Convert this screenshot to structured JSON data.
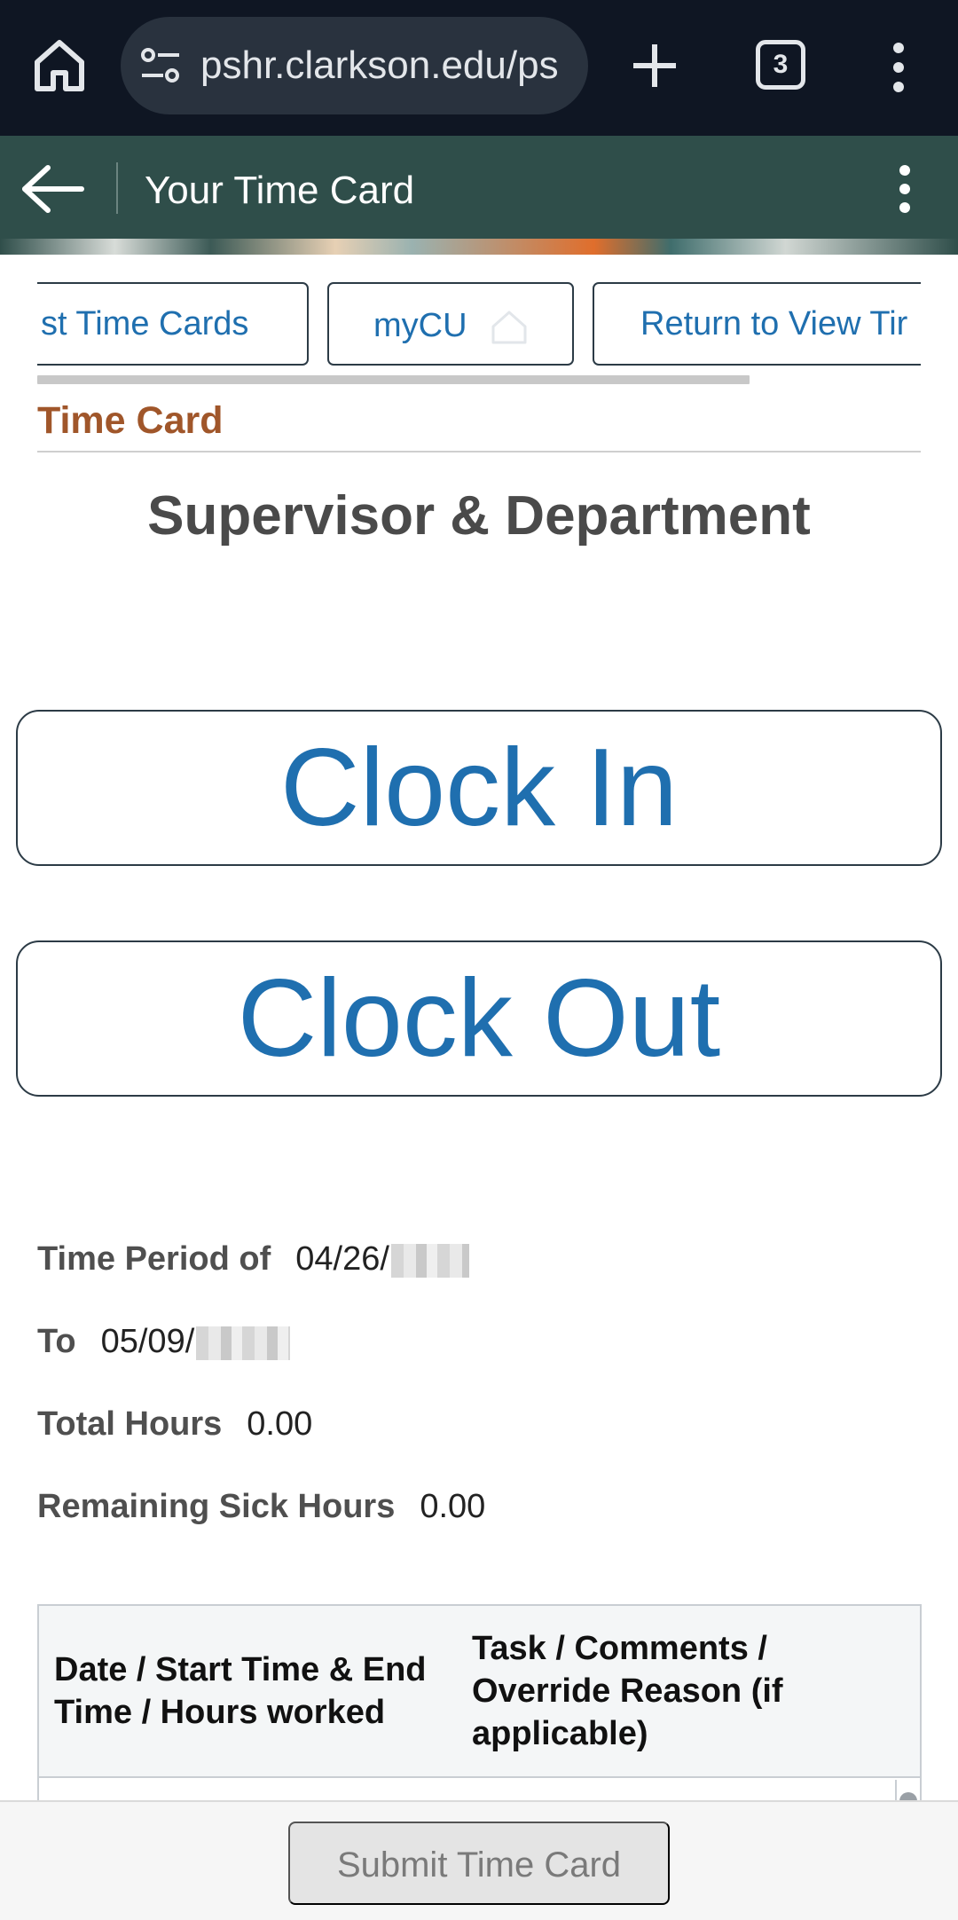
{
  "browser": {
    "url": "pshr.clarkson.edu/ps",
    "tab_count": "3"
  },
  "header": {
    "title": "Your Time Card"
  },
  "tabs": [
    {
      "label": "st Time Cards"
    },
    {
      "label": "myCU"
    },
    {
      "label": "Return to View Tir"
    }
  ],
  "section": {
    "label": "Time Card",
    "heading": "Supervisor & Department"
  },
  "actions": {
    "clock_in": "Clock In",
    "clock_out": "Clock Out",
    "submit": "Submit Time Card"
  },
  "info": {
    "period_label": "Time Period of",
    "period_value": "04/26/",
    "to_label": "To",
    "to_value": "05/09/",
    "total_label": "Total Hours",
    "total_value": "0.00",
    "sick_label": "Remaining Sick Hours",
    "sick_value": "0.00"
  },
  "table": {
    "columns": [
      "Date / Start Time & End Time / Hours worked",
      "Task / Comments / Override Reason (if applicable)"
    ]
  },
  "colors": {
    "browser_bar": "#0f1623",
    "header": "#2f4e4a",
    "link_blue": "#1f6faf",
    "section_label": "#a0562a"
  },
  "icons": {
    "home": "home-icon",
    "site_settings": "tune-icon",
    "new_tab": "plus-icon",
    "overflow": "more-vert-icon",
    "back": "arrow-left-icon",
    "house": "house-icon"
  }
}
